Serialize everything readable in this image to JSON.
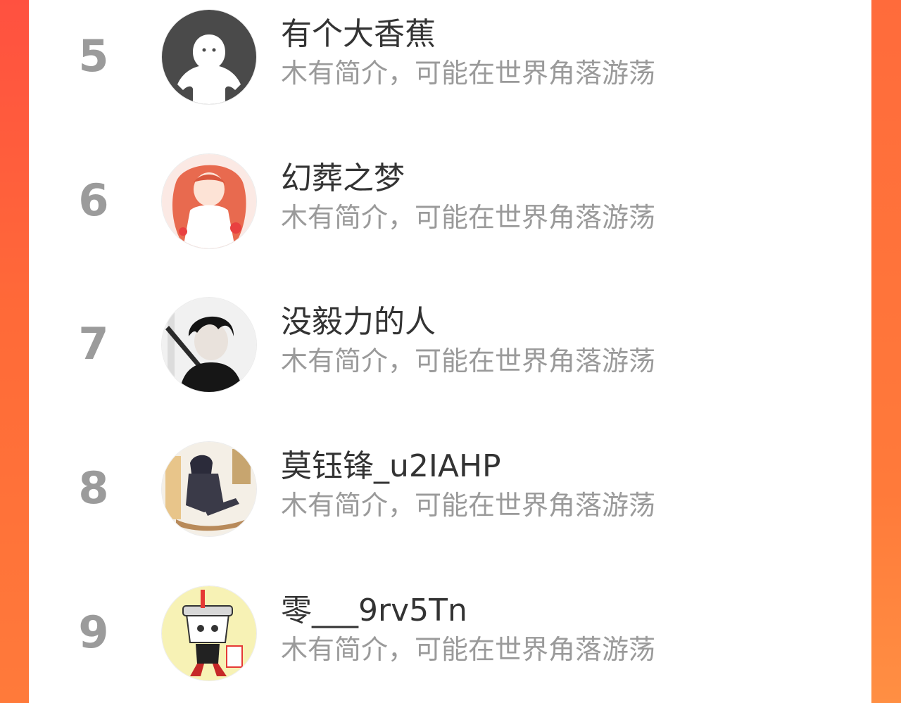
{
  "colors": {
    "background_start": "#ff5140",
    "background_end": "#ff8f43",
    "card": "#ffffff",
    "rank_text": "#9b9b9b",
    "name_text": "#333333",
    "desc_text": "#9a9a9a"
  },
  "users": [
    {
      "rank": "5",
      "name": "有个大香蕉",
      "desc": "木有简介，可能在世界角落游荡",
      "avatar": "default-ghost-avatar"
    },
    {
      "rank": "6",
      "name": "幻葬之梦",
      "desc": "木有简介，可能在世界角落游荡",
      "avatar": "red-haired-girl-avatar"
    },
    {
      "rank": "7",
      "name": "没毅力的人",
      "desc": "木有简介，可能在世界角落游荡",
      "avatar": "dark-haired-swordsman-avatar"
    },
    {
      "rank": "8",
      "name": "莫钰锋_u2IAHP",
      "desc": "木有简介，可能在世界角落游荡",
      "avatar": "anime-soldier-avatar"
    },
    {
      "rank": "9",
      "name": "零___9rv5Tn",
      "desc": "木有简介，可能在世界角落游荡",
      "avatar": "cartoon-cup-character-avatar"
    }
  ]
}
